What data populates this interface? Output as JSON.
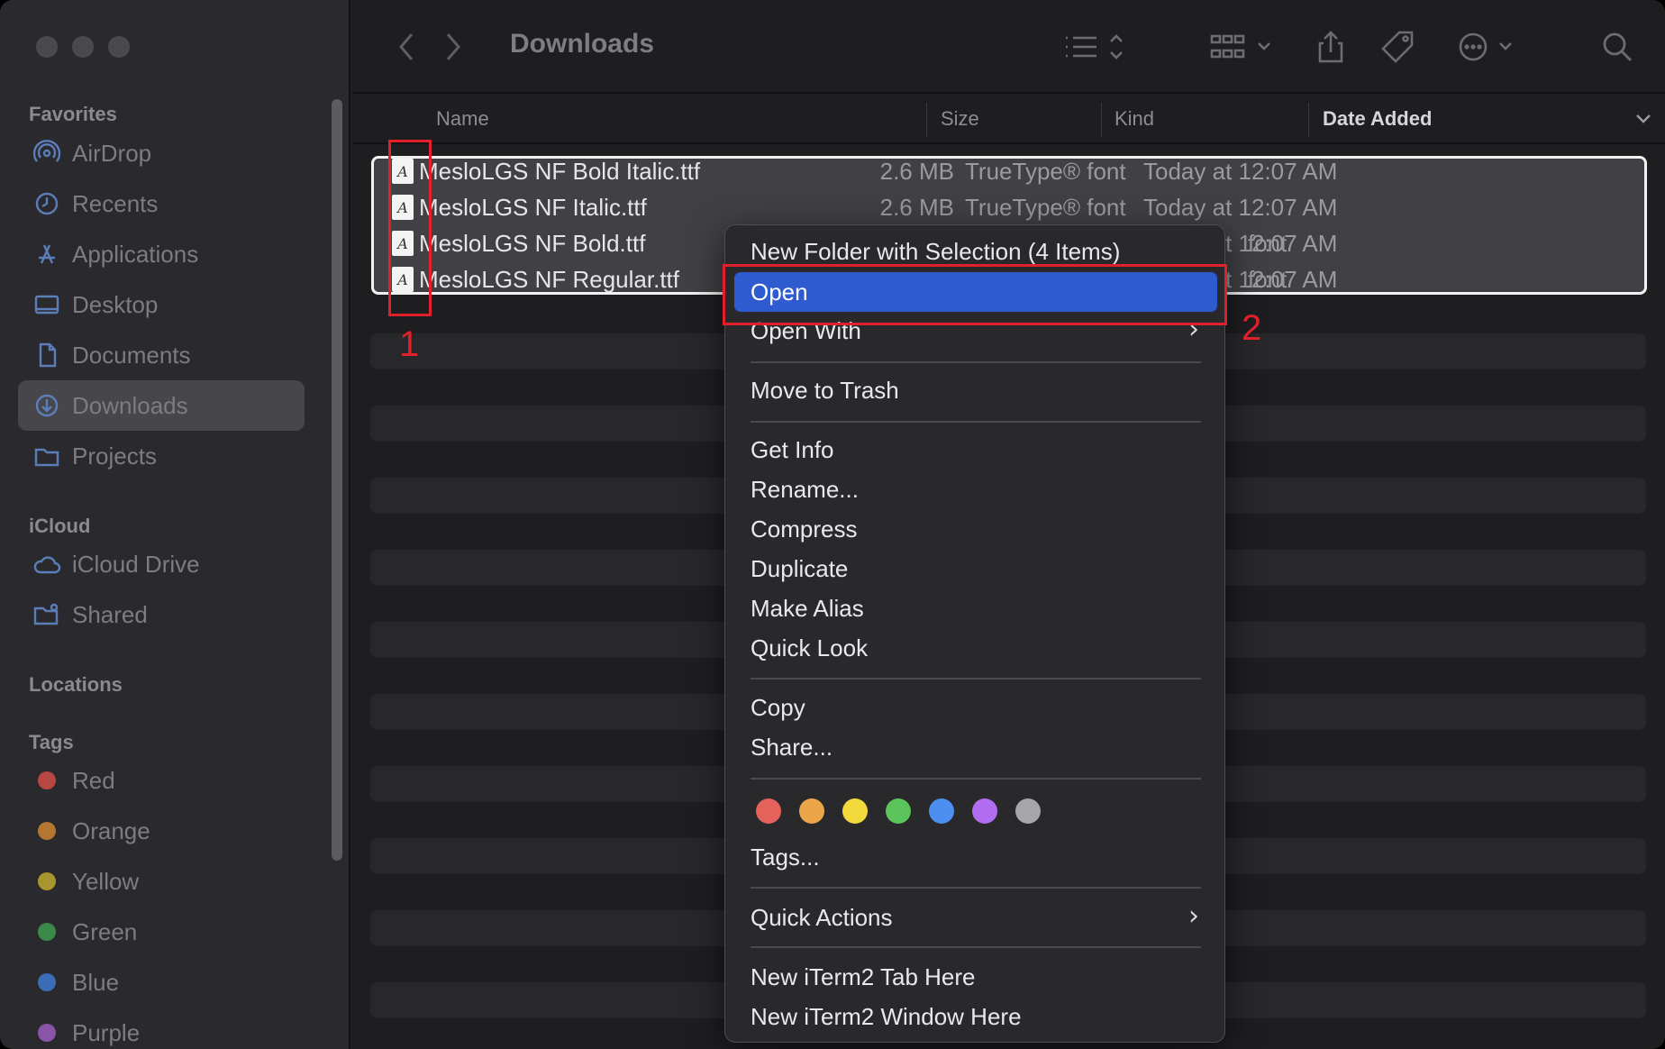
{
  "window": {
    "title": "Downloads"
  },
  "sidebar": {
    "favorites_heading": "Favorites",
    "favorites": [
      {
        "label": "AirDrop",
        "icon": "airdrop-icon"
      },
      {
        "label": "Recents",
        "icon": "clock-icon"
      },
      {
        "label": "Applications",
        "icon": "applications-icon"
      },
      {
        "label": "Desktop",
        "icon": "desktop-icon"
      },
      {
        "label": "Documents",
        "icon": "document-icon"
      },
      {
        "label": "Downloads",
        "icon": "download-icon",
        "active": true
      },
      {
        "label": "Projects",
        "icon": "folder-icon"
      }
    ],
    "icloud_heading": "iCloud",
    "icloud": [
      {
        "label": "iCloud Drive",
        "icon": "cloud-icon"
      },
      {
        "label": "Shared",
        "icon": "shared-folder-icon"
      }
    ],
    "locations_heading": "Locations",
    "tags_heading": "Tags",
    "tags": [
      {
        "label": "Red",
        "color": "#d9534f"
      },
      {
        "label": "Orange",
        "color": "#d9892e"
      },
      {
        "label": "Yellow",
        "color": "#c8b02c"
      },
      {
        "label": "Green",
        "color": "#3aa050"
      },
      {
        "label": "Blue",
        "color": "#3a7bd5"
      },
      {
        "label": "Purple",
        "color": "#9b59b6"
      }
    ]
  },
  "toolbar": {
    "back_icon": "chevron-left-icon",
    "forward_icon": "chevron-right-icon",
    "list_view_icon": "list-icon",
    "grid_view_icon": "grid-icon",
    "share_icon": "share-icon",
    "tag_icon": "tag-icon",
    "more_icon": "ellipsis-circle-icon",
    "search_icon": "search-icon"
  },
  "columns": {
    "name": "Name",
    "size": "Size",
    "kind": "Kind",
    "date_added": "Date Added"
  },
  "files": [
    {
      "name": "MesloLGS NF Bold Italic.ttf",
      "size": "2.6 MB",
      "kind": "TrueType® font",
      "date": "Today at 12:07 AM"
    },
    {
      "name": "MesloLGS NF Italic.ttf",
      "size": "2.6 MB",
      "kind": "TrueType® font",
      "date": "Today at 12:07 AM"
    },
    {
      "name": "MesloLGS NF Bold.ttf",
      "size": "",
      "kind": "font",
      "date": "Today at 12:07 AM"
    },
    {
      "name": "MesloLGS NF Regular.ttf",
      "size": "",
      "kind": "font",
      "date": "Today at 12:07 AM"
    }
  ],
  "context_menu": {
    "new_folder": "New Folder with Selection (4 Items)",
    "open": "Open",
    "open_with": "Open With",
    "move_to_trash": "Move to Trash",
    "get_info": "Get Info",
    "rename": "Rename...",
    "compress": "Compress",
    "duplicate": "Duplicate",
    "make_alias": "Make Alias",
    "quick_look": "Quick Look",
    "copy": "Copy",
    "share": "Share...",
    "tag_colors": [
      "#e5625b",
      "#eda54a",
      "#f2d93c",
      "#5cc45c",
      "#4d8ff0",
      "#b26cf0",
      "#a6a6aa"
    ],
    "tags": "Tags...",
    "quick_actions": "Quick Actions",
    "new_iterm_tab": "New iTerm2 Tab Here",
    "new_iterm_window": "New iTerm2 Window Here"
  },
  "annotations": {
    "step1": "1",
    "step2": "2"
  }
}
